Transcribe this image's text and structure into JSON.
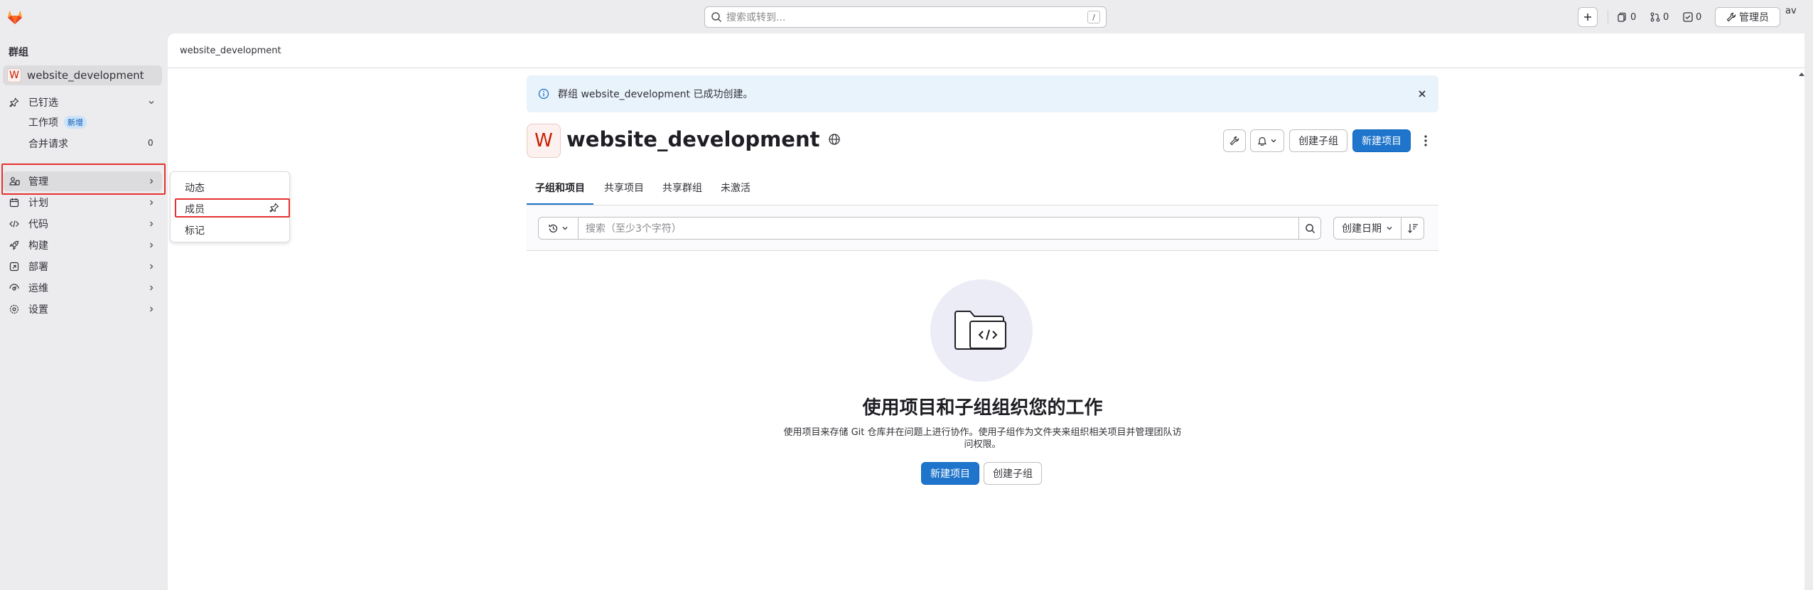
{
  "topbar": {
    "search_placeholder": "搜索或转到...",
    "search_shortcut": "/",
    "issues_count": "0",
    "merge_requests_count": "0",
    "todos_count": "0",
    "admin_label": "管理员",
    "avatar_alt": "av"
  },
  "sidebar": {
    "section_label": "群组",
    "context_initial": "W",
    "context_name": "website_development",
    "pinned": {
      "label": "已钉选",
      "items": [
        {
          "label": "工作项",
          "badge": "新增"
        },
        {
          "label": "合并请求",
          "count": "0"
        }
      ]
    },
    "items": [
      {
        "label": "管理",
        "icon": "users-icon"
      },
      {
        "label": "计划",
        "icon": "calendar-icon"
      },
      {
        "label": "代码",
        "icon": "code-icon"
      },
      {
        "label": "构建",
        "icon": "rocket-icon"
      },
      {
        "label": "部署",
        "icon": "deploy-icon"
      },
      {
        "label": "运维",
        "icon": "monitor-icon"
      },
      {
        "label": "设置",
        "icon": "settings-icon"
      }
    ],
    "flyout": [
      "动态",
      "成员",
      "标记"
    ]
  },
  "main": {
    "breadcrumb": "website_development",
    "alert": "群组 website_development 已成功创建。",
    "group_initial": "W",
    "group_name": "website_development",
    "buttons": {
      "create_subgroup": "创建子组",
      "new_project": "新建项目"
    },
    "tabs": [
      "子组和项目",
      "共享项目",
      "共享群组",
      "未激活"
    ],
    "filter_placeholder": "搜索（至少3个字符）",
    "sort_label": "创建日期",
    "empty": {
      "title": "使用项目和子组组织您的工作",
      "description": "使用项目来存储 Git 仓库并在问题上进行协作。使用子组作为文件夹来组织相关项目并管理团队访问权限。",
      "new_project": "新建项目",
      "create_subgroup": "创建子组"
    }
  },
  "colors": {
    "accent": "#1f75cb",
    "highlight": "#e5302f",
    "alert_bg": "#e9f3fc",
    "brand": "#fc6d26"
  }
}
